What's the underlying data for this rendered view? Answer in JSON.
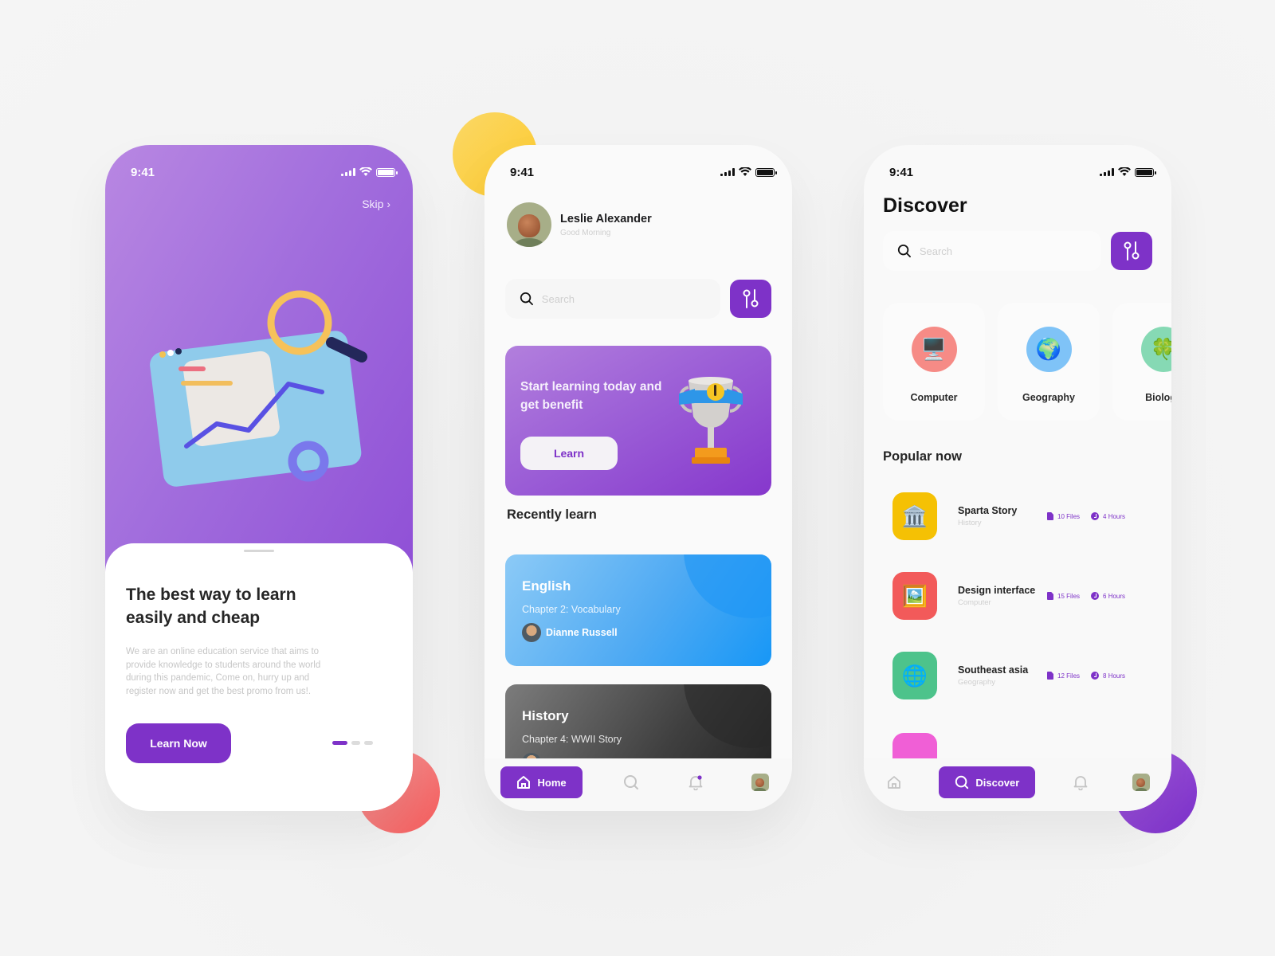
{
  "colors": {
    "accent": "#7e32c8",
    "blob_yellow": "#fcc92b",
    "blob_red": "#f45a5a",
    "blob_purple": "#7b2fc9"
  },
  "onboarding": {
    "status_time": "9:41",
    "skip_label": "Skip",
    "skip_icon": "chevron-right-icon",
    "title": "The best way to learn easily and cheap",
    "description": "We are an online education service that aims to provide knowledge to students around the world during this pandemic, Come on, hurry up and register now and get the best promo from us!.",
    "cta_label": "Learn Now",
    "pagination": {
      "total": 3,
      "current": 1
    }
  },
  "home": {
    "status_time": "9:41",
    "user": {
      "name": "Leslie Alexander",
      "greeting": "Good Morning"
    },
    "search": {
      "placeholder": "Search",
      "value": ""
    },
    "promo": {
      "title": "Start learning today and get benefit",
      "button_label": "Learn"
    },
    "recently_title": "Recently learn",
    "recent_courses": [
      {
        "subject": "English",
        "chapter": "Chapter 2: Vocabulary",
        "teacher": "Dianne Russell"
      },
      {
        "subject": "History",
        "chapter": "Chapter 4: WWII Story",
        "teacher": ""
      }
    ],
    "nav": {
      "home_label": "Home",
      "active": "home"
    }
  },
  "discover": {
    "status_time": "9:41",
    "title": "Discover",
    "search": {
      "placeholder": "Search",
      "value": ""
    },
    "categories": [
      {
        "label": "Computer",
        "icon": "🖥️",
        "color": "#f68b86"
      },
      {
        "label": "Geography",
        "icon": "🌍",
        "color": "#7fc3f7"
      },
      {
        "label": "Biology",
        "icon": "🍀",
        "color": "#86d9b4"
      }
    ],
    "popular_title": "Popular now",
    "popular": [
      {
        "title": "Sparta Story",
        "category": "History",
        "files": "10 Files",
        "hours": "4 Hours",
        "icon": "🏛️",
        "color": "#f5c104"
      },
      {
        "title": "Design interface",
        "category": "Computer",
        "files": "15 Files",
        "hours": "6 Hours",
        "icon": "🖼️",
        "color": "#f25a5a"
      },
      {
        "title": "Southeast asia",
        "category": "Geography",
        "files": "12 Files",
        "hours": "8 Hours",
        "icon": "🌐",
        "color": "#4dc38b"
      }
    ],
    "nav": {
      "discover_label": "Discover",
      "active": "discover"
    }
  }
}
